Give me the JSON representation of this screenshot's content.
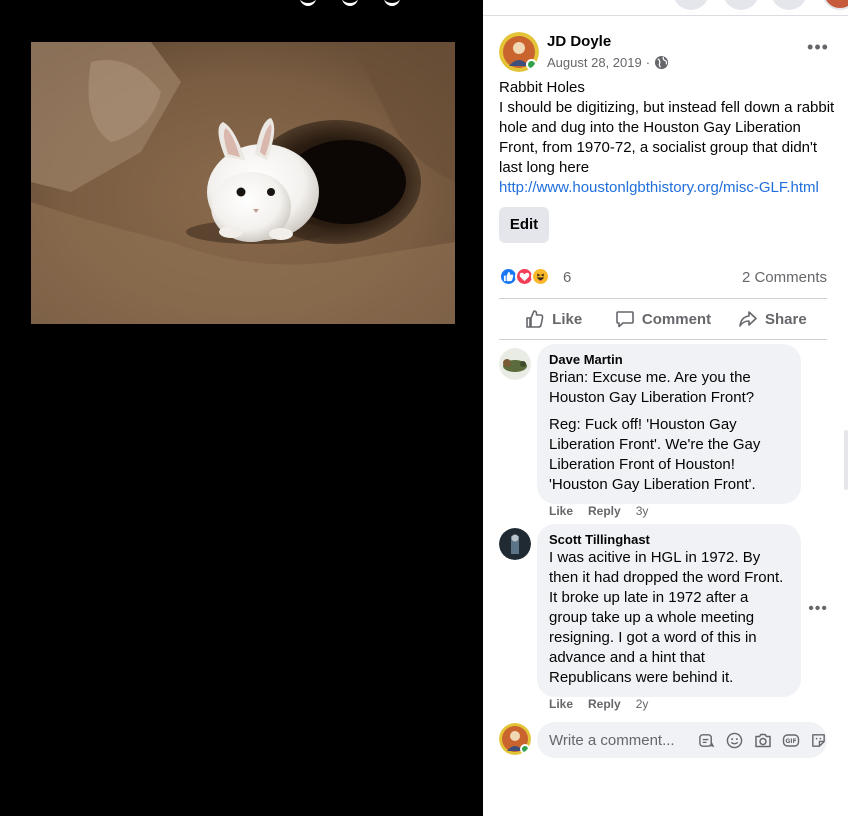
{
  "post": {
    "author": "JD Doyle",
    "date": "August 28, 2019",
    "date_separator": "·",
    "title": "Rabbit Holes",
    "body": "I should be digitizing, but instead fell down a rabbit hole and dug into the Houston Gay Liberation Front, from 1970-72, a socialist group that didn't last long here",
    "link": "http://www.houstonlgbthistory.org/misc-GLF.html",
    "edit_label": "Edit",
    "menu_icon": "more-horizontal-icon",
    "audience_icon": "globe-icon"
  },
  "reactions": {
    "icons": [
      "like-reaction-icon",
      "love-reaction-icon",
      "haha-reaction-icon"
    ],
    "count": "6",
    "comments": "2 Comments"
  },
  "actions": {
    "like": "Like",
    "comment": "Comment",
    "share": "Share"
  },
  "comments": [
    {
      "name": "Dave Martin",
      "paragraphs": [
        "Brian: Excuse me. Are you the Houston Gay Liberation Front?",
        "Reg: Fuck off! 'Houston Gay Liberation Front'. We're the Gay Liberation Front of Houston! 'Houston Gay Liberation Front'."
      ],
      "like": "Like",
      "reply": "Reply",
      "age": "3y"
    },
    {
      "name": "Scott Tillinghast",
      "paragraphs": [
        "I was acitive in HGL in 1972. By then it had dropped the word Front. It broke up late in 1972 after a group take up a whole meeting resigning. I got a word of this in advance and a hint that Republicans were behind it."
      ],
      "like": "Like",
      "reply": "Reply",
      "age": "2y"
    }
  ],
  "composer": {
    "placeholder": "Write a comment...",
    "tools": [
      "sticker-comment-icon",
      "emoji-icon",
      "camera-icon",
      "gif-icon",
      "sticker-icon"
    ]
  },
  "colors": {
    "link": "#216fdb",
    "online": "#31a24c",
    "like_blue": "#1877f2",
    "love_red": "#f33e58",
    "haha_yellow": "#f7b928"
  }
}
